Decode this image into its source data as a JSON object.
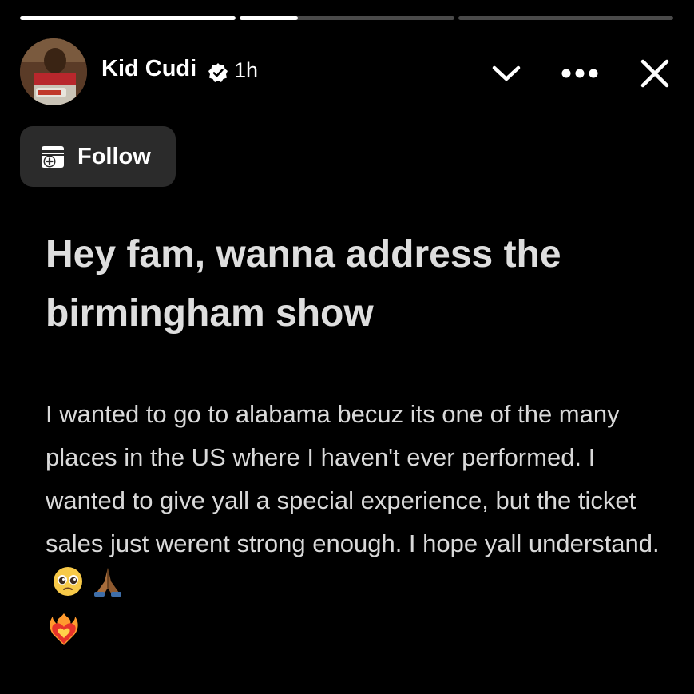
{
  "story": {
    "progress_segments": [
      1,
      0.27,
      0
    ]
  },
  "header": {
    "username": "Kid Cudi",
    "time": "1h",
    "avatar_icon": "profile-photo",
    "verified_icon": "verified-badge-icon",
    "chevron_icon": "chevron-down-icon",
    "more_icon": "more-icon",
    "close_icon": "close-icon"
  },
  "follow": {
    "label": "Follow",
    "icon": "follow-add-icon"
  },
  "post": {
    "headline": "Hey fam, wanna address the birmingham show",
    "body": "I wanted to go to alabama becuz its one of the many places in the US where I haven't ever performed.  I wanted to give yall a special experience, but the ticket sales just werent strong enough.  I hope yall understand.",
    "emojis": [
      "pleading-face-emoji",
      "folded-hands-emoji",
      "heart-on-fire-emoji"
    ]
  },
  "colors": {
    "background": "#000000",
    "follow_button": "#2b2b2b",
    "progress_track": "#4a4a4a",
    "progress_fill": "#ffffff"
  }
}
